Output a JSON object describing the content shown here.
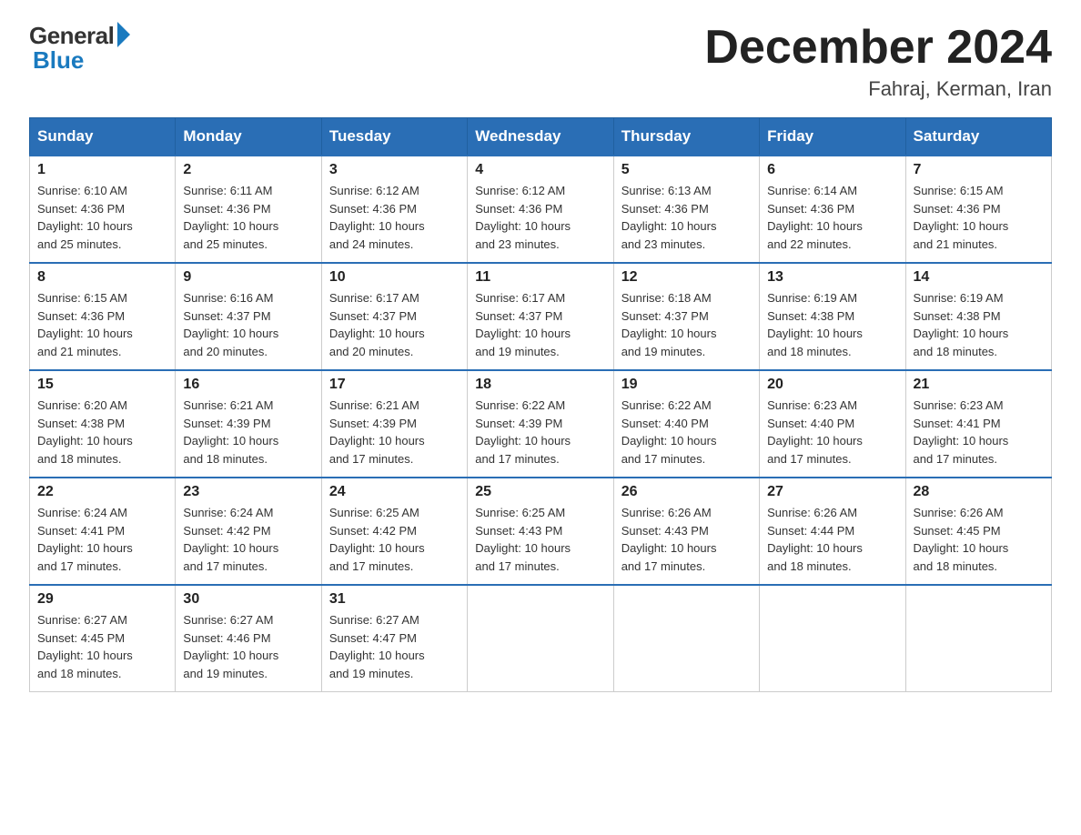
{
  "header": {
    "logo_general": "General",
    "logo_blue": "Blue",
    "month_title": "December 2024",
    "location": "Fahraj, Kerman, Iran"
  },
  "days_of_week": [
    "Sunday",
    "Monday",
    "Tuesday",
    "Wednesday",
    "Thursday",
    "Friday",
    "Saturday"
  ],
  "weeks": [
    [
      {
        "day": "1",
        "sunrise": "6:10 AM",
        "sunset": "4:36 PM",
        "daylight": "10 hours and 25 minutes."
      },
      {
        "day": "2",
        "sunrise": "6:11 AM",
        "sunset": "4:36 PM",
        "daylight": "10 hours and 25 minutes."
      },
      {
        "day": "3",
        "sunrise": "6:12 AM",
        "sunset": "4:36 PM",
        "daylight": "10 hours and 24 minutes."
      },
      {
        "day": "4",
        "sunrise": "6:12 AM",
        "sunset": "4:36 PM",
        "daylight": "10 hours and 23 minutes."
      },
      {
        "day": "5",
        "sunrise": "6:13 AM",
        "sunset": "4:36 PM",
        "daylight": "10 hours and 23 minutes."
      },
      {
        "day": "6",
        "sunrise": "6:14 AM",
        "sunset": "4:36 PM",
        "daylight": "10 hours and 22 minutes."
      },
      {
        "day": "7",
        "sunrise": "6:15 AM",
        "sunset": "4:36 PM",
        "daylight": "10 hours and 21 minutes."
      }
    ],
    [
      {
        "day": "8",
        "sunrise": "6:15 AM",
        "sunset": "4:36 PM",
        "daylight": "10 hours and 21 minutes."
      },
      {
        "day": "9",
        "sunrise": "6:16 AM",
        "sunset": "4:37 PM",
        "daylight": "10 hours and 20 minutes."
      },
      {
        "day": "10",
        "sunrise": "6:17 AM",
        "sunset": "4:37 PM",
        "daylight": "10 hours and 20 minutes."
      },
      {
        "day": "11",
        "sunrise": "6:17 AM",
        "sunset": "4:37 PM",
        "daylight": "10 hours and 19 minutes."
      },
      {
        "day": "12",
        "sunrise": "6:18 AM",
        "sunset": "4:37 PM",
        "daylight": "10 hours and 19 minutes."
      },
      {
        "day": "13",
        "sunrise": "6:19 AM",
        "sunset": "4:38 PM",
        "daylight": "10 hours and 18 minutes."
      },
      {
        "day": "14",
        "sunrise": "6:19 AM",
        "sunset": "4:38 PM",
        "daylight": "10 hours and 18 minutes."
      }
    ],
    [
      {
        "day": "15",
        "sunrise": "6:20 AM",
        "sunset": "4:38 PM",
        "daylight": "10 hours and 18 minutes."
      },
      {
        "day": "16",
        "sunrise": "6:21 AM",
        "sunset": "4:39 PM",
        "daylight": "10 hours and 18 minutes."
      },
      {
        "day": "17",
        "sunrise": "6:21 AM",
        "sunset": "4:39 PM",
        "daylight": "10 hours and 17 minutes."
      },
      {
        "day": "18",
        "sunrise": "6:22 AM",
        "sunset": "4:39 PM",
        "daylight": "10 hours and 17 minutes."
      },
      {
        "day": "19",
        "sunrise": "6:22 AM",
        "sunset": "4:40 PM",
        "daylight": "10 hours and 17 minutes."
      },
      {
        "day": "20",
        "sunrise": "6:23 AM",
        "sunset": "4:40 PM",
        "daylight": "10 hours and 17 minutes."
      },
      {
        "day": "21",
        "sunrise": "6:23 AM",
        "sunset": "4:41 PM",
        "daylight": "10 hours and 17 minutes."
      }
    ],
    [
      {
        "day": "22",
        "sunrise": "6:24 AM",
        "sunset": "4:41 PM",
        "daylight": "10 hours and 17 minutes."
      },
      {
        "day": "23",
        "sunrise": "6:24 AM",
        "sunset": "4:42 PM",
        "daylight": "10 hours and 17 minutes."
      },
      {
        "day": "24",
        "sunrise": "6:25 AM",
        "sunset": "4:42 PM",
        "daylight": "10 hours and 17 minutes."
      },
      {
        "day": "25",
        "sunrise": "6:25 AM",
        "sunset": "4:43 PM",
        "daylight": "10 hours and 17 minutes."
      },
      {
        "day": "26",
        "sunrise": "6:26 AM",
        "sunset": "4:43 PM",
        "daylight": "10 hours and 17 minutes."
      },
      {
        "day": "27",
        "sunrise": "6:26 AM",
        "sunset": "4:44 PM",
        "daylight": "10 hours and 18 minutes."
      },
      {
        "day": "28",
        "sunrise": "6:26 AM",
        "sunset": "4:45 PM",
        "daylight": "10 hours and 18 minutes."
      }
    ],
    [
      {
        "day": "29",
        "sunrise": "6:27 AM",
        "sunset": "4:45 PM",
        "daylight": "10 hours and 18 minutes."
      },
      {
        "day": "30",
        "sunrise": "6:27 AM",
        "sunset": "4:46 PM",
        "daylight": "10 hours and 19 minutes."
      },
      {
        "day": "31",
        "sunrise": "6:27 AM",
        "sunset": "4:47 PM",
        "daylight": "10 hours and 19 minutes."
      },
      null,
      null,
      null,
      null
    ]
  ],
  "labels": {
    "sunrise": "Sunrise:",
    "sunset": "Sunset:",
    "daylight": "Daylight:"
  }
}
